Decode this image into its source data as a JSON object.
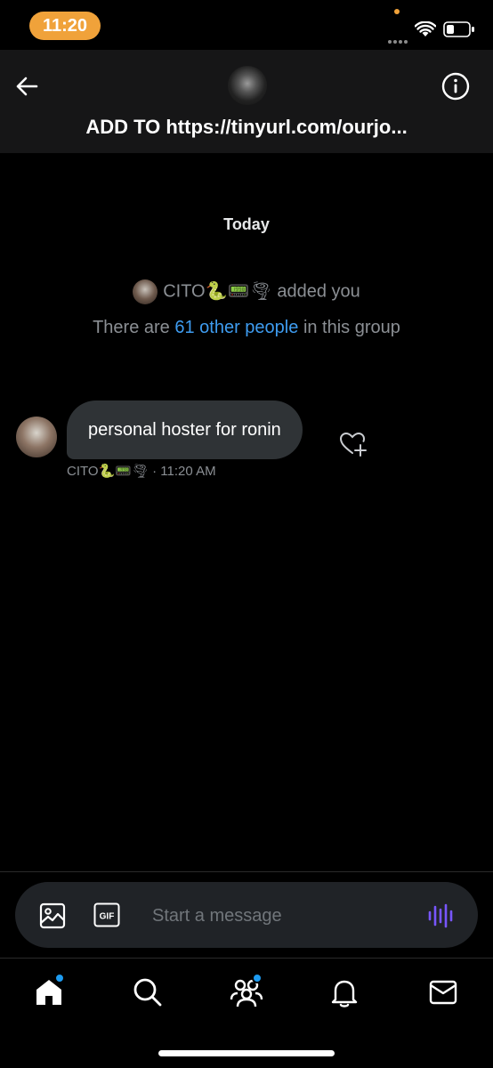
{
  "status_bar": {
    "time": "11:20"
  },
  "header": {
    "title": "ADD TO https://tinyurl.com/ourjo..."
  },
  "chat": {
    "date_separator": "Today",
    "system": {
      "adder_name": "CITO",
      "adder_emojis": "🐍📟🌪",
      "action": "added you",
      "count_prefix": "There are",
      "count_link": "61 other people",
      "count_suffix": "in this group"
    },
    "messages": [
      {
        "text": "personal hoster for ronin",
        "sender_name": "CITO",
        "sender_emojis": "🐍📟🌪",
        "time": "· 11:20 AM"
      }
    ]
  },
  "composer": {
    "placeholder": "Start a message",
    "gif_label": "GIF"
  },
  "colors": {
    "accent": "#1d9bf0",
    "link": "#3e9cf0",
    "voice": "#7856ff",
    "time_pill": "#f0a23a"
  },
  "bottom_nav": {
    "items": [
      {
        "icon": "home-icon",
        "badge": true
      },
      {
        "icon": "search-icon",
        "badge": false
      },
      {
        "icon": "communities-icon",
        "badge": true
      },
      {
        "icon": "notifications-icon",
        "badge": false
      },
      {
        "icon": "messages-icon",
        "badge": false
      }
    ]
  }
}
